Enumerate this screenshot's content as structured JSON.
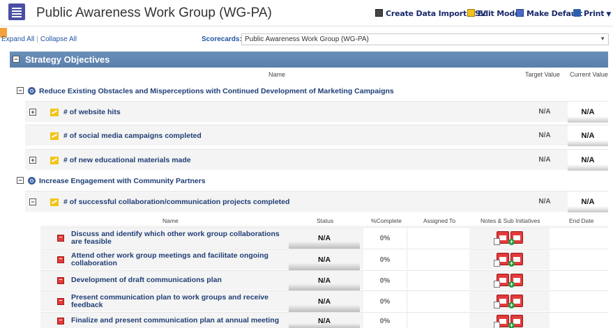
{
  "header": {
    "title": "Public Awareness Work Group (WG-PA)",
    "actions": {
      "create_csv": "Create Data Import CSV",
      "edit_mode": "Edit Mode",
      "make_default": "Make Default",
      "print": "Print"
    }
  },
  "toolbar": {
    "expand_all": "Expand All",
    "separator": "|",
    "collapse_all": "Collapse All",
    "scorecards_label": "Scorecards:",
    "scorecards_value": "Public Awareness Work Group (WG-PA)"
  },
  "section": {
    "title": "Strategy Objectives",
    "columns": {
      "name": "Name",
      "target": "Target Value",
      "current": "Current Value"
    }
  },
  "objectives": [
    {
      "name": "Reduce Existing Obstacles and Misperceptions with Continued Development of Marketing Campaigns",
      "measures": [
        {
          "name": "# of website hits",
          "target": "N/A",
          "current": "N/A"
        },
        {
          "name": "# of social media campaigns completed",
          "target": "N/A",
          "current": "N/A"
        },
        {
          "name": "# of new educational materials made",
          "target": "N/A",
          "current": "N/A"
        }
      ]
    },
    {
      "name": "Increase Engagement with Community Partners",
      "measures": [
        {
          "name": "# of successful collaboration/communication projects completed",
          "target": "N/A",
          "current": "N/A"
        }
      ]
    }
  ],
  "initiatives": {
    "columns": {
      "name": "Name",
      "status": "Status",
      "complete": "%Complete",
      "assigned": "Assigned To",
      "notes": "Notes & Sub Initiatives",
      "end": "End Date"
    },
    "rows": [
      {
        "name": "Discuss and identify which other work group collaborations are feasible",
        "status": "N/A",
        "complete": "0%"
      },
      {
        "name": "Attend other work group meetings and facilitate ongoing collaboration",
        "status": "N/A",
        "complete": "0%"
      },
      {
        "name": "Development of draft communications plan",
        "status": "N/A",
        "complete": "0%"
      },
      {
        "name": "Present communication plan to work groups and receive feedback",
        "status": "N/A",
        "complete": "0%"
      },
      {
        "name": "Finalize and present communication plan at annual meeting",
        "status": "N/A",
        "complete": "0%"
      }
    ]
  },
  "toggles": {
    "collapse": "−",
    "expand": "+"
  }
}
